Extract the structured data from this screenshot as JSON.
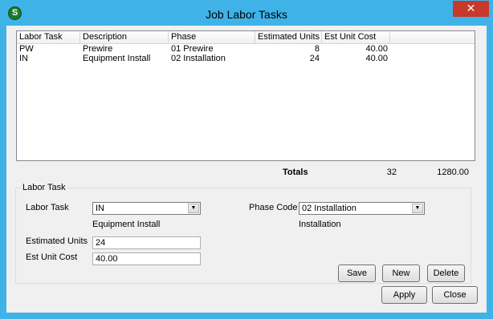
{
  "window": {
    "title": "Job Labor Tasks",
    "app_icon_letter": "S",
    "close_glyph": "✕"
  },
  "grid": {
    "columns": [
      "Labor Task",
      "Description",
      "Phase",
      "Estimated Units",
      "Est Unit Cost"
    ],
    "rows": [
      [
        "PW",
        "Prewire",
        "01 Prewire",
        "8",
        "40.00"
      ],
      [
        "IN",
        "Equipment Install",
        "02 Installation",
        "24",
        "40.00"
      ]
    ]
  },
  "totals": {
    "label": "Totals",
    "units": "32",
    "cost": "1280.00"
  },
  "labor_task": {
    "legend": "Labor Task",
    "task_label": "Labor Task",
    "task_value": "IN",
    "task_description": "Equipment Install",
    "phase_label": "Phase Code",
    "phase_value": "02 Installation",
    "phase_description": "Installation",
    "units_label": "Estimated Units",
    "units_value": "24",
    "cost_label": "Est Unit Cost",
    "cost_value": "40.00",
    "save_label": "Save",
    "new_label": "New",
    "delete_label": "Delete"
  },
  "footer": {
    "apply_label": "Apply",
    "close_label": "Close"
  },
  "icons": {
    "app": "app-logo-icon",
    "close": "close-icon",
    "dropdown": "chevron-down-icon"
  }
}
